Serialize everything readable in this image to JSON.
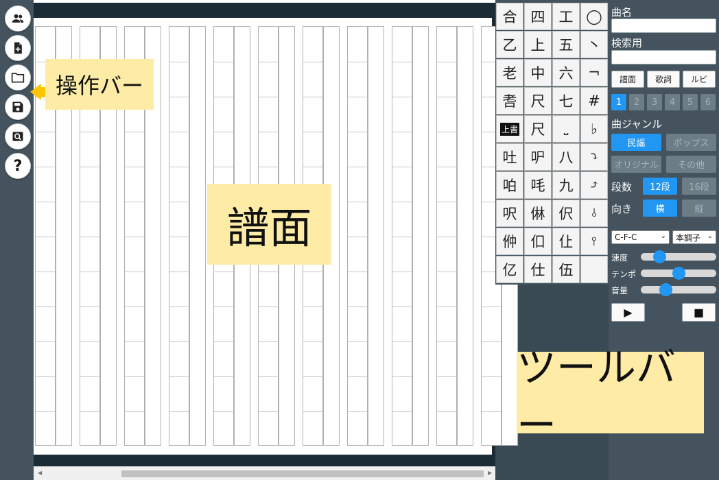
{
  "action_bar": {
    "buttons": [
      {
        "name": "users-button",
        "icon": "users-icon"
      },
      {
        "name": "new-file-button",
        "icon": "file-add-icon"
      },
      {
        "name": "open-folder-button",
        "icon": "folder-icon"
      },
      {
        "name": "save-button",
        "icon": "save-icon"
      },
      {
        "name": "search-button",
        "icon": "search-icon"
      },
      {
        "name": "help-button",
        "icon": "help-icon",
        "glyph": "?"
      }
    ]
  },
  "annotations": {
    "action_bar_label": "操作バー",
    "score_label": "譜面",
    "toolbar_label": "ツールバー"
  },
  "palette": {
    "rows": [
      [
        "合",
        "四",
        "工",
        "◯"
      ],
      [
        "乙",
        "上",
        "五",
        "丶"
      ],
      [
        "老",
        "中",
        "六",
        "¬"
      ],
      [
        "㖈",
        "尺",
        "七",
        "#"
      ],
      [
        "上書",
        "尺",
        "⎵",
        "♭"
      ],
      [
        "吐",
        "㕧",
        "八",
        "⤵"
      ],
      [
        "㕷",
        "㕰",
        "九",
        "⤴"
      ],
      [
        "呎",
        "㑣",
        "伬",
        "⫰"
      ],
      [
        "㑖",
        "㐰",
        "仩",
        "⫯"
      ],
      [
        "亿",
        "仕",
        "伍",
        ""
      ]
    ]
  },
  "toolbar": {
    "song_name_label": "曲名",
    "song_name_value": "",
    "search_label": "検索用",
    "search_value": "",
    "modes": [
      "譜面",
      "歌詞",
      "ルビ"
    ],
    "pages": [
      "1",
      "2",
      "3",
      "4",
      "5",
      "6"
    ],
    "active_page": "1",
    "genre_label": "曲ジャンル",
    "genres": [
      "民謡",
      "ポップス",
      "オリジナル",
      "その他"
    ],
    "active_genre": "民謡",
    "rows_label": "段数",
    "rows_options": [
      "12段",
      "16段"
    ],
    "active_rows": "12段",
    "direction_label": "向き",
    "direction_options": [
      "横",
      "縦"
    ],
    "active_direction": "横",
    "tuning_select": "C-F-C",
    "key_select": "本調子",
    "sliders": [
      {
        "label": "速度",
        "value": 0.2
      },
      {
        "label": "テンポ",
        "value": 0.5
      },
      {
        "label": "音量",
        "value": 0.3
      }
    ],
    "play_glyph": "▶",
    "stop_glyph": "■"
  },
  "colors": {
    "accent": "#2196f3",
    "callout": "#feeba6",
    "arrow": "#ffc400"
  }
}
